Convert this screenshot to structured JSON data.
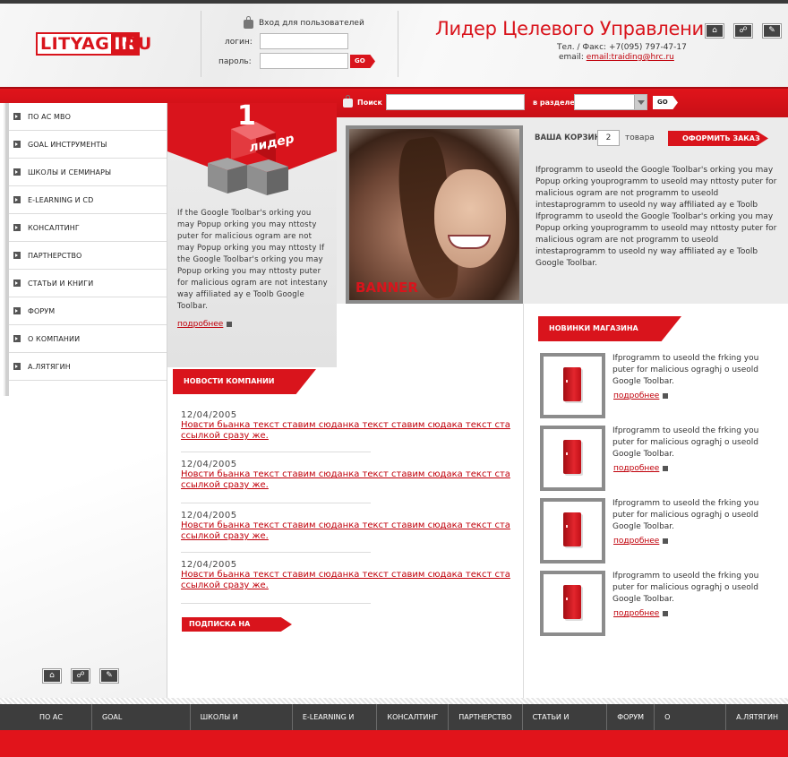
{
  "brand": {
    "logo_part1": "LITYAG",
    "logo_part2": "IN",
    "logo_suffix": ".RU",
    "slogan": "Лидер Целевого Управления"
  },
  "login": {
    "title": "Вход для пользователей",
    "login_label": "логин:",
    "password_label": "пароль:",
    "go_label": "GO"
  },
  "contacts": {
    "phone": "Тел. / Факс: +7(095) 797-47-17",
    "email_label": "email:",
    "email": "email:traiding@hrc.ru"
  },
  "search": {
    "label": "Поиск",
    "section_label": "в разделе",
    "go_label": "GO"
  },
  "nav": {
    "items": [
      "ПО АС МВО",
      "GOAL ИНСТРУМЕНТЫ",
      "ШКОЛЫ И  СЕМИНАРЫ",
      "E-LEARNING И CD",
      "КОНСАЛТИНГ",
      "ПАРТНЕРСТВО",
      "СТАТЬИ И КНИГИ",
      "ФОРУМ",
      "О КОМПАНИИ",
      "А.ЛЯТЯГИН"
    ]
  },
  "leader": {
    "number": "1",
    "word": "лидер",
    "text": "If the Google Toolbar's orking you may Popup orking you may nttosty puter for malicious ogram  are not may Popup orking you may nttosty If the Google Toolbar's orking you may Popup orking you may nttosty puter for malicious ogram  are not intestany way affiliated ay e Toolb Google Toolbar.",
    "more": "подробнее"
  },
  "banner": {
    "label": "BANNER"
  },
  "cart": {
    "label": "ВАША КОРЗИНА",
    "count": "2",
    "word": "товара",
    "order_button": "ОФОРМИТЬ ЗАКАЗ"
  },
  "intro_text": "Ifprogramm to useold  the Google Toolbar's orking you may Popup orking youprogramm to useold  may nttosty puter for malicious ogram  are not programm to useold intestaprogramm to useold ny way affiliated ay e Toolb Ifprogramm to useold  the Google Toolbar's orking you may Popup orking youprogramm to useold  may nttosty puter for malicious ogram  are not programm to useold intestaprogramm to useold ny way affiliated ay e Toolb Google Toolbar.",
  "news": {
    "title": "НОВОСТИ КОМПАНИИ",
    "items": [
      {
        "date": "12/04/2005",
        "line1": "Новсти бьанка текст ставим сюданка текст ставим сюдака текст ста",
        "line2": "ссылкой сразу же."
      },
      {
        "date": "12/04/2005",
        "line1": "Новсти бьанка текст ставим сюданка текст ставим сюдака текст ста",
        "line2": "ссылкой сразу же."
      },
      {
        "date": "12/04/2005",
        "line1": "Новсти бьанка текст ставим сюданка текст ставим сюдака текст ста",
        "line2": "ссылкой сразу же."
      },
      {
        "date": "12/04/2005",
        "line1": "Новсти бьанка текст ставим сюданка текст ставим сюдака текст ста",
        "line2": "ссылкой сразу же."
      }
    ],
    "subscribe": "ПОДПИСКА НА НОВОСТИ"
  },
  "shop": {
    "title": "НОВИНКИ МАГАЗИНА",
    "items": [
      {
        "text": "Ifprogramm to useold  the frking you puter for malicious ograghj o useold Google Toolbar.",
        "more": "подробнее"
      },
      {
        "text": "Ifprogramm to useold  the frking you puter for malicious ograghj o useold Google Toolbar.",
        "more": "подробнее"
      },
      {
        "text": "Ifprogramm to useold  the frking you puter for malicious ograghj o useold Google Toolbar.",
        "more": "подробнее"
      },
      {
        "text": "Ifprogramm to useold  the frking you puter for malicious ograghj o useold Google Toolbar.",
        "more": "подробнее"
      }
    ]
  },
  "footer": {
    "items": [
      "ПО АС МВО",
      "GOAL ИНСТРУМЕНТЫ",
      "ШКОЛЫ И  СЕМИНАРЫ",
      "E-LEARNING И CD",
      "КОНСАЛТИНГ",
      "ПАРТНЕРСТВО",
      "СТАТЬИ И КНИГИ",
      "ФОРУМ",
      "О КОМПАНИИ",
      "А.ЛЯТЯГИН"
    ]
  },
  "icons": {
    "home": "home-icon",
    "sitemap": "sitemap-icon",
    "mail": "mail-icon"
  },
  "colors": {
    "accent": "#d9141c",
    "dark": "#3d3d3d"
  }
}
